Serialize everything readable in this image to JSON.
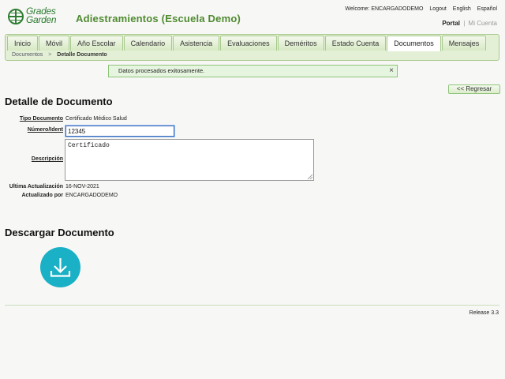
{
  "brand": {
    "logo_line1": "Grades",
    "logo_line2": "Garden",
    "school_title": "Adiestramientos (Escuela Demo)"
  },
  "header": {
    "welcome": "Welcome: ENCARGADODEMO",
    "logout": "Logout",
    "english": "English",
    "espanol": "Español",
    "portal": "Portal",
    "portal_sep": "|",
    "mi_cuenta": "Mi Cuenta"
  },
  "nav": {
    "tabs": [
      "Inicio",
      "Móvil",
      "Año Escolar",
      "Calendario",
      "Asistencia",
      "Evaluaciones",
      "Deméritos",
      "Estado Cuenta",
      "Documentos",
      "Mensajes"
    ],
    "active_tab": "Documentos"
  },
  "breadcrumb": {
    "parent": "Documentos",
    "sep": ">",
    "current": "Detalle Documento"
  },
  "alert": {
    "message": "Datos procesados exitosamente.",
    "close": "×"
  },
  "back_button": "<< Regresar",
  "detail": {
    "heading": "Detalle de Documento",
    "tipo_label": "Tipo Documento",
    "tipo_value": "Certificado Médico Salud",
    "numero_label": "Número/Ident",
    "numero_value": "12345",
    "descripcion_label": "Descripción",
    "descripcion_value": "Certificado",
    "ultima_label": "Ultima Actualización",
    "ultima_value": "16-NOV-2021",
    "actualizado_label": "Actualizado por",
    "actualizado_value": "ENCARGADODEMO"
  },
  "download": {
    "heading": "Descargar Documento",
    "icon": "download-icon",
    "color": "#1ab0c5"
  },
  "footer": {
    "release": "Release 3.3"
  },
  "colors": {
    "brand_green": "#2e7d32",
    "title_green": "#4f8a2f",
    "nav_bg": "#e4f0d6",
    "alert_bg": "#e6f5df"
  }
}
